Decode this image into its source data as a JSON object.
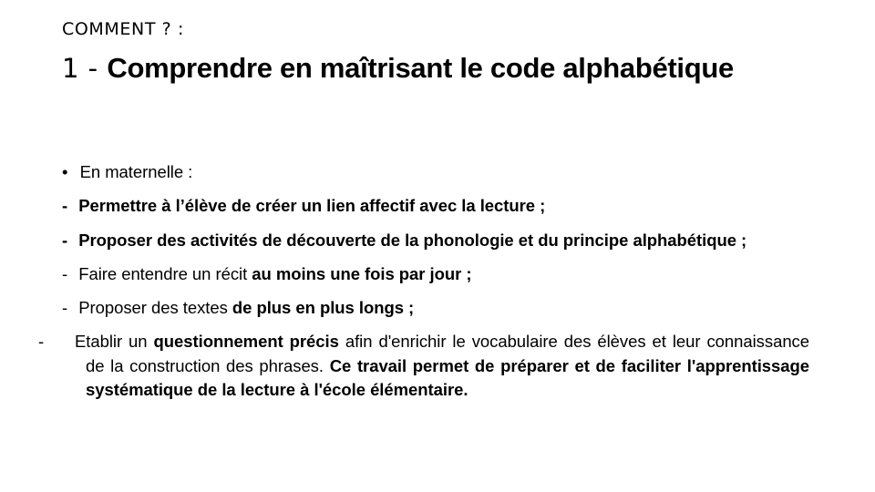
{
  "slide": {
    "background_color": "#ffffff",
    "text_color": "#000000",
    "eyebrow": "COMMENT ? :",
    "title": {
      "number_prefix": "1 - ",
      "main": "Comprendre en maîtrisant le code alphabétique"
    },
    "body": {
      "intro": {
        "marker": "•",
        "text": "En maternelle :"
      },
      "items": [
        {
          "marker": "-",
          "marker_weight": "bold",
          "runs": [
            {
              "text": "Permettre à l’élève de créer un lien affectif avec la lecture ;",
              "weight": "bold"
            }
          ]
        },
        {
          "marker": "-",
          "marker_weight": "bold",
          "justified": true,
          "runs": [
            {
              "text": "Proposer des activités de découverte de la phonologie et du principe",
              "weight": "bold"
            }
          ],
          "tail": {
            "text": "alphabétique ;",
            "weight": "bold"
          }
        },
        {
          "marker": "-",
          "marker_weight": "light",
          "runs": [
            {
              "text": "Faire entendre un récit ",
              "weight": "regular"
            },
            {
              "text": "au moins une fois par jour ;",
              "weight": "bold"
            }
          ]
        },
        {
          "marker": "-",
          "marker_weight": "light",
          "runs": [
            {
              "text": "Proposer des textes ",
              "weight": "regular"
            },
            {
              "text": "de plus en plus longs ;",
              "weight": "bold"
            }
          ]
        },
        {
          "marker": "-",
          "marker_weight": "light",
          "justified": true,
          "hanging": true,
          "runs": [
            {
              "text": "Etablir un ",
              "weight": "regular"
            },
            {
              "text": "questionnement précis",
              "weight": "bold"
            },
            {
              "text": " afin d'enrichir le vocabulaire des élèves et leur connaissance de la construction des phrases. ",
              "weight": "regular"
            },
            {
              "text": "Ce travail permet de préparer et de faciliter l'apprentissage systématique de la lecture à",
              "weight": "bold"
            }
          ],
          "tail": {
            "text": "l'école élémentaire.",
            "weight": "bold"
          }
        }
      ]
    }
  }
}
